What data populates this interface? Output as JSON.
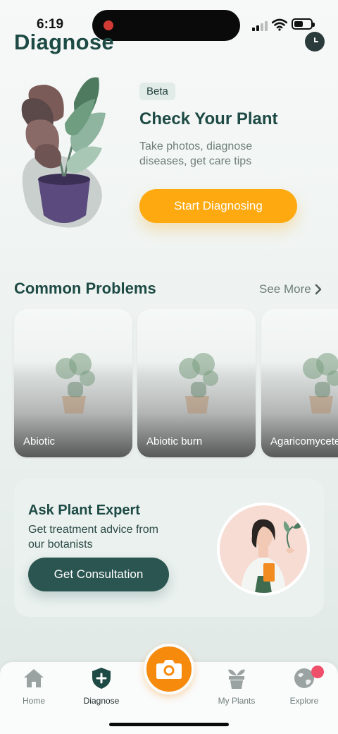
{
  "status_bar": {
    "time": "6:19"
  },
  "header": {
    "title": "Diagnose",
    "history_icon": "clock-icon"
  },
  "hero": {
    "badge": "Beta",
    "title": "Check Your Plant",
    "subtitle": "Take photos, diagnose diseases, get care tips",
    "cta_label": "Start Diagnosing",
    "cta_color": "#fda90f"
  },
  "problems": {
    "title": "Common Problems",
    "see_more_label": "See More",
    "items": [
      {
        "label": "Abiotic"
      },
      {
        "label": "Abiotic burn"
      },
      {
        "label": "Agaricomycetes"
      }
    ]
  },
  "expert": {
    "title": "Ask Plant Expert",
    "subtitle": "Get treatment advice from our botanists",
    "cta_label": "Get Consultation",
    "cta_color": "#2b5550"
  },
  "tab_bar": {
    "tabs": [
      {
        "label": "Home",
        "icon": "home-icon",
        "active": false
      },
      {
        "label": "Diagnose",
        "icon": "shield-plus-icon",
        "active": true
      },
      {
        "label": "My Plants",
        "icon": "plant-pot-icon",
        "active": false
      },
      {
        "label": "Explore",
        "icon": "globe-icon",
        "active": false
      }
    ],
    "camera_icon": "camera-icon",
    "accent": "#f58a0c"
  }
}
